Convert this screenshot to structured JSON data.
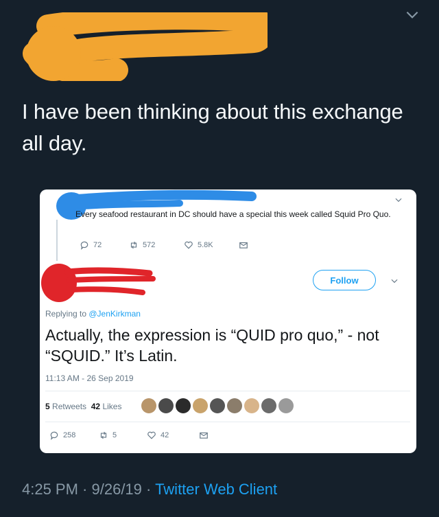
{
  "outer_tweet": {
    "text": "I have been thinking about this exchange all day.",
    "time": "4:25 PM",
    "date": "9/26/19",
    "client": "Twitter Web Client",
    "separator": " · "
  },
  "embedded": {
    "parent_tweet": {
      "text": "Every seafood restaurant in DC should have a special this week called Squid Pro Quo.",
      "replies": "72",
      "retweets": "572",
      "likes": "5.8K"
    },
    "follow_label": "Follow",
    "replying_prefix": "Replying to ",
    "replying_handle": "@JenKirkman",
    "reply_text": "Actually, the expression is “QUID pro quo,” - not “SQUID.” It’s Latin.",
    "timestamp": "11:13 AM - 26 Sep 2019",
    "stats": {
      "retweets_count": "5",
      "retweets_label": "Retweets",
      "likes_count": "42",
      "likes_label": "Likes"
    },
    "actions": {
      "replies": "258",
      "retweets": "5",
      "likes": "42"
    }
  },
  "colors": {
    "background": "#15202b",
    "accent": "#1da1f2",
    "redaction_orange": "#f2a531",
    "redaction_blue": "#2e8ce6",
    "redaction_red": "#e0252a"
  }
}
